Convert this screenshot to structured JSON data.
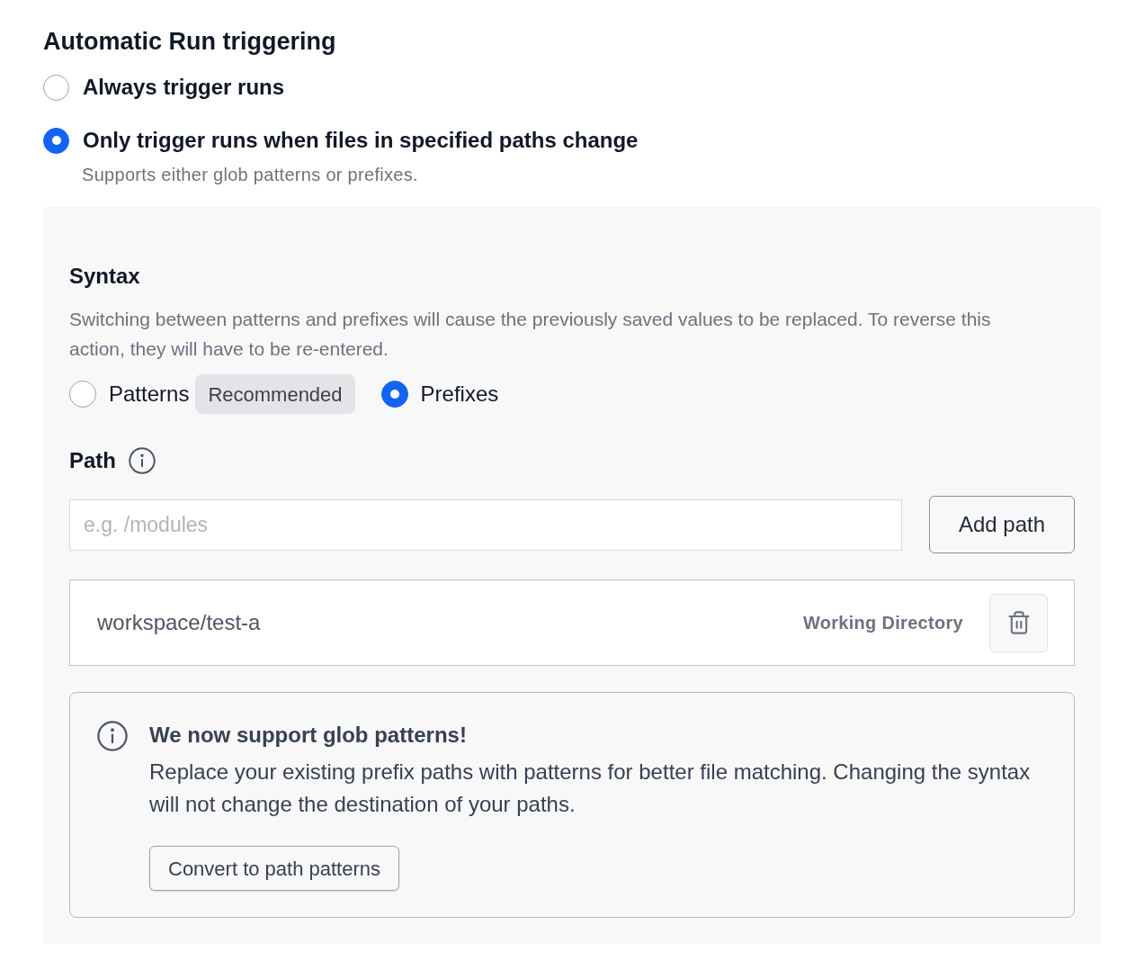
{
  "section": {
    "title": "Automatic Run triggering",
    "options": [
      {
        "label": "Always trigger runs",
        "selected": false
      },
      {
        "label": "Only trigger runs when files in specified paths change",
        "selected": true,
        "description": "Supports either glob patterns or prefixes."
      }
    ]
  },
  "syntax": {
    "title": "Syntax",
    "description": "Switching between patterns and prefixes will cause the previously saved values to be replaced. To reverse this action, they will have to be re-entered.",
    "options": [
      {
        "label": "Patterns",
        "selected": false,
        "badge": "Recommended"
      },
      {
        "label": "Prefixes",
        "selected": true
      }
    ]
  },
  "path": {
    "label": "Path",
    "input": {
      "placeholder": "e.g. /modules"
    },
    "add_button": "Add path",
    "entries": [
      {
        "path": "workspace/test-a",
        "tag": "Working Directory"
      }
    ]
  },
  "notice": {
    "title": "We now support glob patterns!",
    "text": "Replace your existing prefix paths with patterns for better file matching. Changing the syntax will not change the destination of your paths.",
    "button": "Convert to path patterns"
  }
}
